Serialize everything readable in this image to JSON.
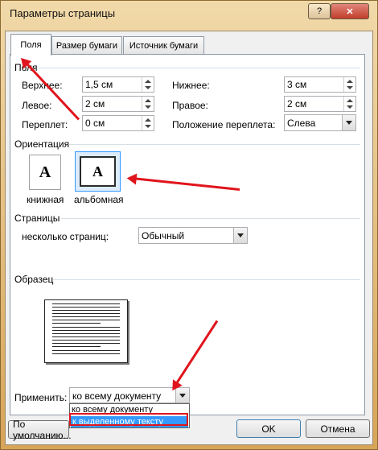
{
  "window": {
    "title": "Параметры страницы",
    "help_glyph": "?",
    "close_glyph": "✕"
  },
  "tabs": [
    "Поля",
    "Размер бумаги",
    "Источник бумаги"
  ],
  "margins": {
    "section": "Поля",
    "top_label": "Верхнее:",
    "top_value": "1,5 см",
    "bottom_label": "Нижнее:",
    "bottom_value": "3 см",
    "left_label": "Левое:",
    "left_value": "2 см",
    "right_label": "Правое:",
    "right_value": "2 см",
    "gutter_label": "Переплет:",
    "gutter_value": "0 см",
    "gutter_pos_label": "Положение переплета:",
    "gutter_pos_value": "Слева"
  },
  "orientation": {
    "section": "Ориентация",
    "portrait_glyph": "A",
    "portrait_label": "книжная",
    "landscape_glyph": "A",
    "landscape_label": "альбомная",
    "selected": "landscape"
  },
  "pages": {
    "section": "Страницы",
    "multiple_label": "несколько страниц:",
    "multiple_value": "Обычный"
  },
  "preview": {
    "section": "Образец"
  },
  "apply": {
    "label": "Применить:",
    "value": "ко всему документу",
    "options": [
      "ко всему документу",
      "к выделенному тексту"
    ],
    "highlighted": "к выделенному тексту"
  },
  "buttons": {
    "default": "По умолчанию...",
    "ok": "OK",
    "cancel": "Отмена"
  },
  "colors": {
    "annotation_arrow": "#e0141c",
    "selection": "#3399ff",
    "highlight_box": "#e0141c"
  }
}
